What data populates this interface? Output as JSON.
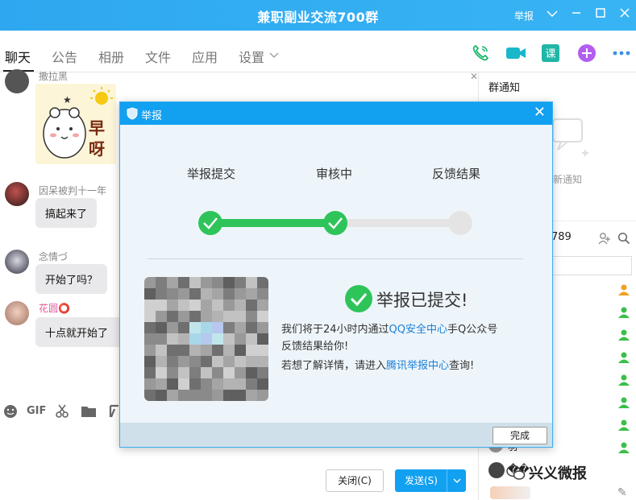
{
  "window": {
    "title": "兼职副业交流700群",
    "report_label": "举报"
  },
  "tabs": [
    "聊天",
    "公告",
    "相册",
    "文件",
    "应用",
    "设置"
  ],
  "chat": {
    "messages": [
      {
        "sender": "撒拉黑",
        "text": "",
        "sticker_text": "早呀"
      },
      {
        "sender": "因呆被判十一年",
        "text": "搞起来了"
      },
      {
        "sender": "念情づ",
        "text": "开始了吗？"
      },
      {
        "sender": "花圆⭕",
        "text": "十点就开始了"
      }
    ],
    "tools": [
      "GIF"
    ],
    "close_button": "关闭(C)",
    "send_button": "发送(S)"
  },
  "right_panel": {
    "notice_title": "群通知",
    "notice_empty": "新通知",
    "member_count_partial": "789",
    "member_partial_1": "羽",
    "member_partial_2": "��"
  },
  "modal": {
    "title": "举报",
    "steps": [
      "举报提交",
      "审核中",
      "反馈结果"
    ],
    "progress": 0.5,
    "result_title": "举报已提交!",
    "line1_prefix": "我们将于24小时内通过",
    "line1_link": "QQ安全中心",
    "line1_suffix": "手Q公众号",
    "line2": "反馈结果给你!",
    "line3_prefix": "若想了解详情，请进入",
    "line3_link": "腾讯举报中心",
    "line3_suffix": "查询!",
    "done_button": "完成"
  },
  "watermark": "兴义微报",
  "colors": {
    "accent": "#12a0f0",
    "success": "#2fc45a",
    "link": "#1a7fd9"
  }
}
